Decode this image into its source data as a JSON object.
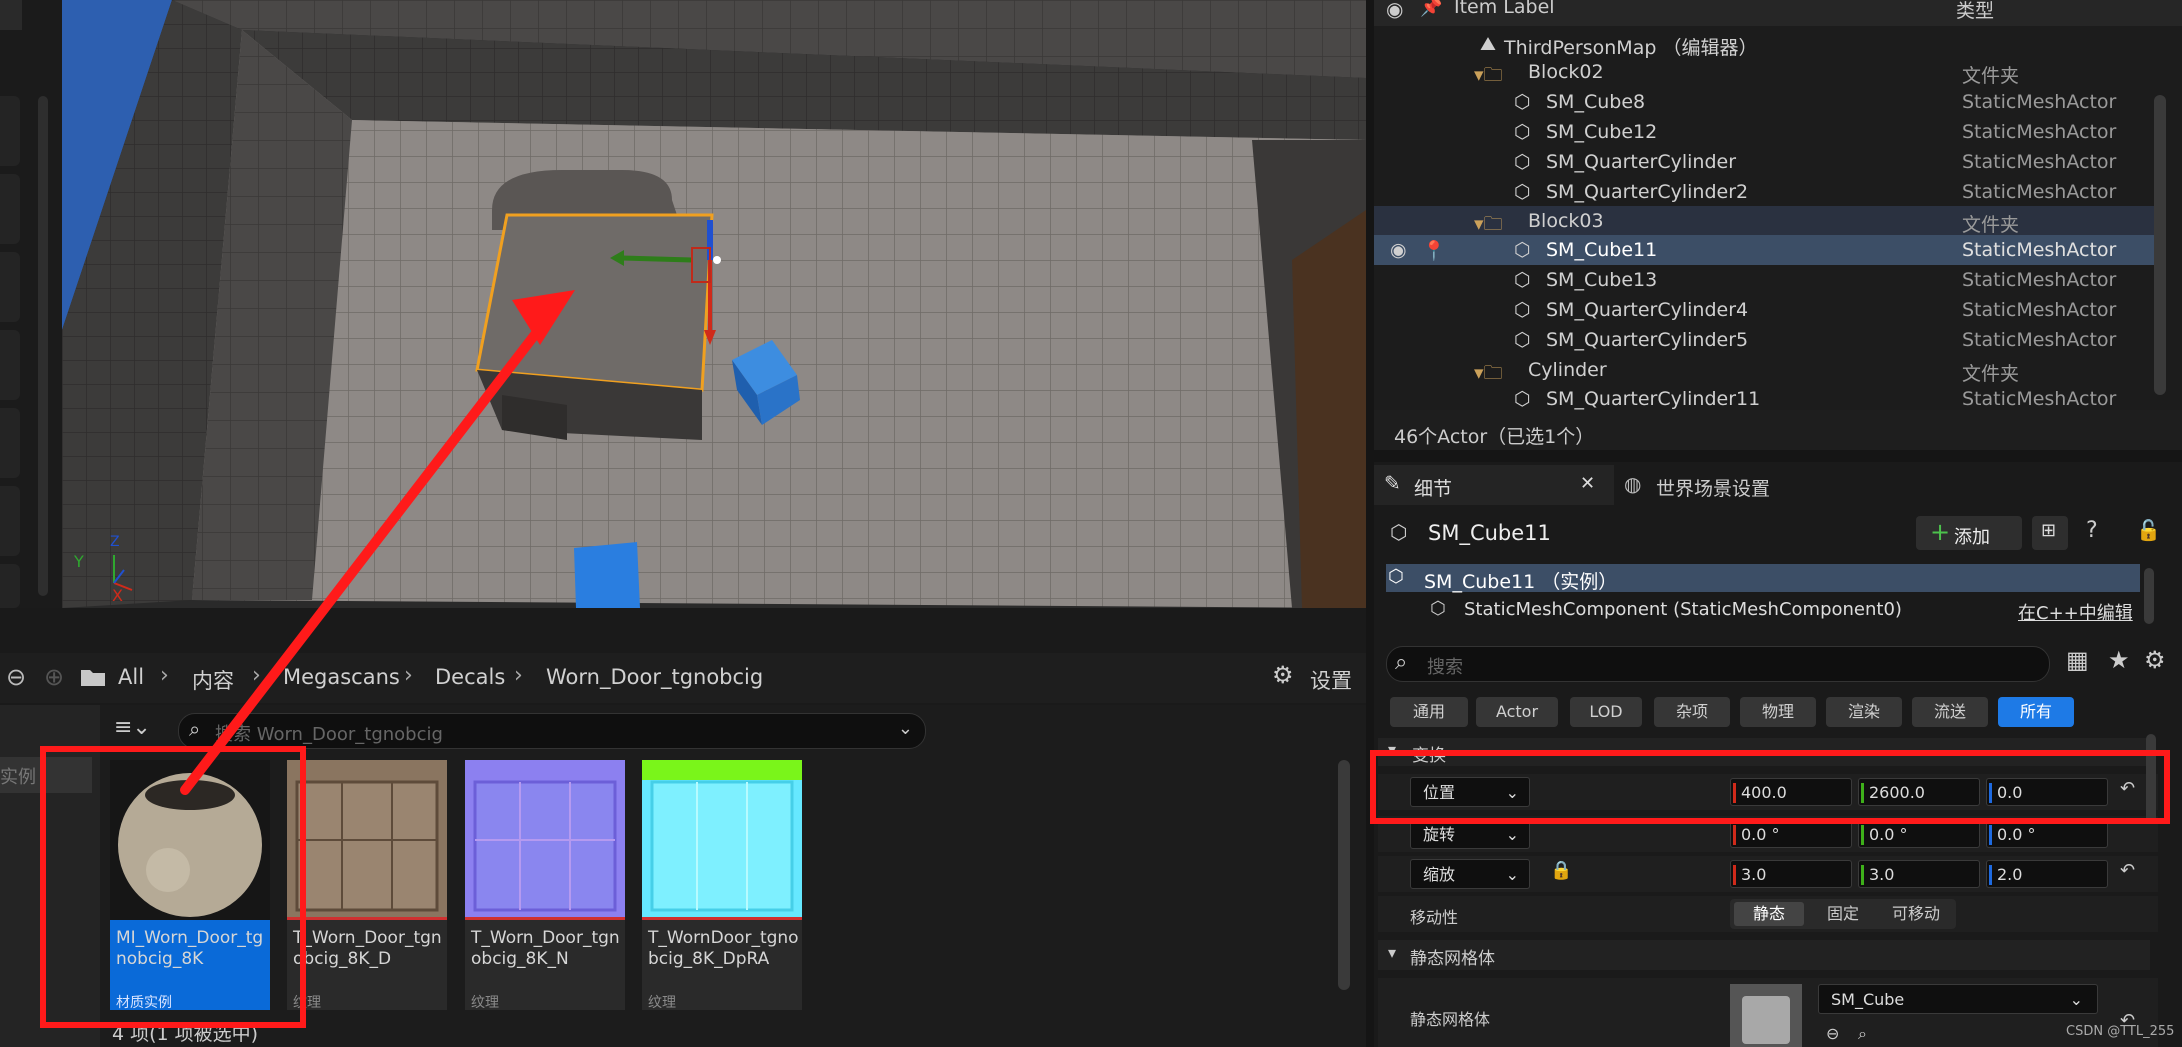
{
  "viewport": {
    "axis_y": "Y",
    "axis_x": "X",
    "axis_z": "Z"
  },
  "content_browser": {
    "breadcrumb": [
      "All",
      "内容",
      "Megascans",
      "Decals",
      "Worn_Door_tgnobcig"
    ],
    "settings_label": "设置",
    "search_placeholder": "搜索 Worn_Door_tgnobcig",
    "left_label": "实例",
    "status": "4 项(1 项被选中)",
    "assets": [
      {
        "name": "MI_Worn_Door_tgnobcig_8K",
        "kind": "材质实例"
      },
      {
        "name": "T_Worn_Door_tgnobcig_8K_D",
        "kind": "纹理"
      },
      {
        "name": "T_Worn_Door_tgnobcig_8K_N",
        "kind": "纹理"
      },
      {
        "name": "T_WornDoor_tgnobcig_8K_DpRA",
        "kind": "纹理"
      }
    ]
  },
  "outliner": {
    "col_label": "Item Label",
    "col_type": "类型",
    "rows": [
      {
        "label": "ThirdPersonMap （编辑器）",
        "type": ""
      },
      {
        "label": "Block02",
        "type": "文件夹"
      },
      {
        "label": "SM_Cube8",
        "type": "StaticMeshActor"
      },
      {
        "label": "SM_Cube12",
        "type": "StaticMeshActor"
      },
      {
        "label": "SM_QuarterCylinder",
        "type": "StaticMeshActor"
      },
      {
        "label": "SM_QuarterCylinder2",
        "type": "StaticMeshActor"
      },
      {
        "label": "Block03",
        "type": "文件夹"
      },
      {
        "label": "SM_Cube11",
        "type": "StaticMeshActor"
      },
      {
        "label": "SM_Cube13",
        "type": "StaticMeshActor"
      },
      {
        "label": "SM_QuarterCylinder4",
        "type": "StaticMeshActor"
      },
      {
        "label": "SM_QuarterCylinder5",
        "type": "StaticMeshActor"
      },
      {
        "label": "Cylinder",
        "type": "文件夹"
      },
      {
        "label": "SM_QuarterCylinder11",
        "type": "StaticMeshActor"
      }
    ],
    "footer": "46个Actor（已选1个）"
  },
  "details": {
    "tab_details": "细节",
    "tab_world": "世界场景设置",
    "actor_name": "SM_Cube11",
    "add_label": "添加",
    "instance_label": "SM_Cube11 （实例）",
    "component_label": "StaticMeshComponent (StaticMeshComponent0)",
    "cpp_link": "在C++中编辑",
    "search_placeholder": "搜索",
    "filters": [
      "通用",
      "Actor",
      "LOD",
      "杂项",
      "物理",
      "渲染",
      "流送",
      "所有"
    ],
    "section_transform": "变换",
    "location": {
      "label": "位置",
      "x": "400.0",
      "y": "2600.0",
      "z": "0.0"
    },
    "rotation": {
      "label": "旋转",
      "x": "0.0 °",
      "y": "0.0 °",
      "z": "0.0 °"
    },
    "scale": {
      "label": "缩放",
      "x": "3.0",
      "y": "3.0",
      "z": "2.0"
    },
    "mobility": {
      "label": "移动性",
      "options": [
        "静态",
        "固定",
        "可移动"
      ]
    },
    "section_mesh": "静态网格体",
    "mesh_label": "静态网格体",
    "mesh_value": "SM_Cube"
  },
  "watermark": "CSDN @TTL_255"
}
